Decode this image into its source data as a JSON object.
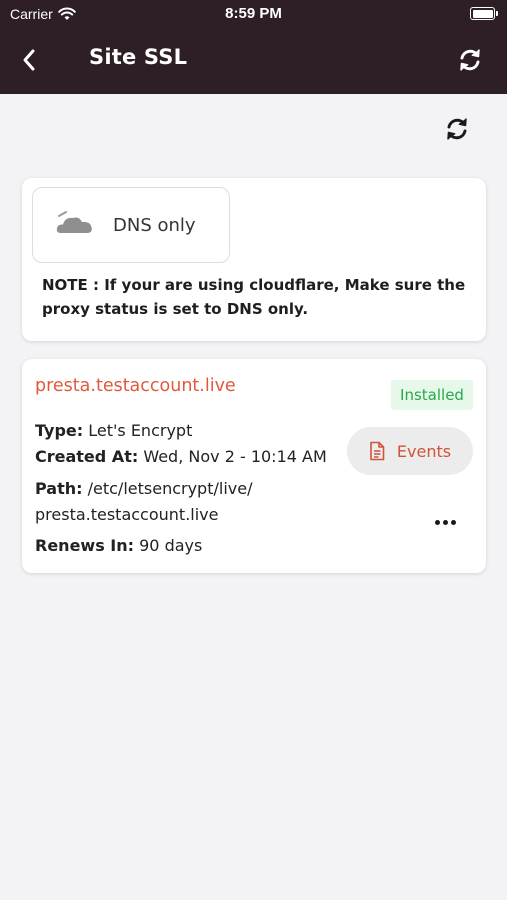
{
  "status_bar": {
    "carrier": "Carrier",
    "time": "8:59 PM"
  },
  "nav": {
    "title": "Site SSL"
  },
  "dns": {
    "mode_label": "DNS only",
    "note": "NOTE : If your are using cloudflare, Make sure the proxy status is set to DNS only."
  },
  "certificate": {
    "domain": "presta.testaccount.live",
    "status": "Installed",
    "type_label": "Type:",
    "type_value": "Let's Encrypt",
    "created_label": "Created At:",
    "created_value": "Wed, Nov 2 - 10:14 AM",
    "path_label": "Path:",
    "path_value_1": "/etc/letsencrypt/live/",
    "path_value_2": "presta.testaccount.live",
    "renews_label": "Renews In:",
    "renews_value": "90 days",
    "events_label": "Events"
  },
  "icons": {
    "wifi": "wifi-icon",
    "battery": "battery-icon",
    "back": "chevron-left-icon",
    "refresh": "refresh-icon",
    "cloud": "cloud-icon",
    "document": "document-icon",
    "more": "more-horizontal-icon"
  },
  "colors": {
    "header_bg": "#2e1e26",
    "page_bg": "#f3f3f6",
    "accent": "#e0593c",
    "badge_bg": "#e6f8ea",
    "badge_text": "#27a94a"
  }
}
